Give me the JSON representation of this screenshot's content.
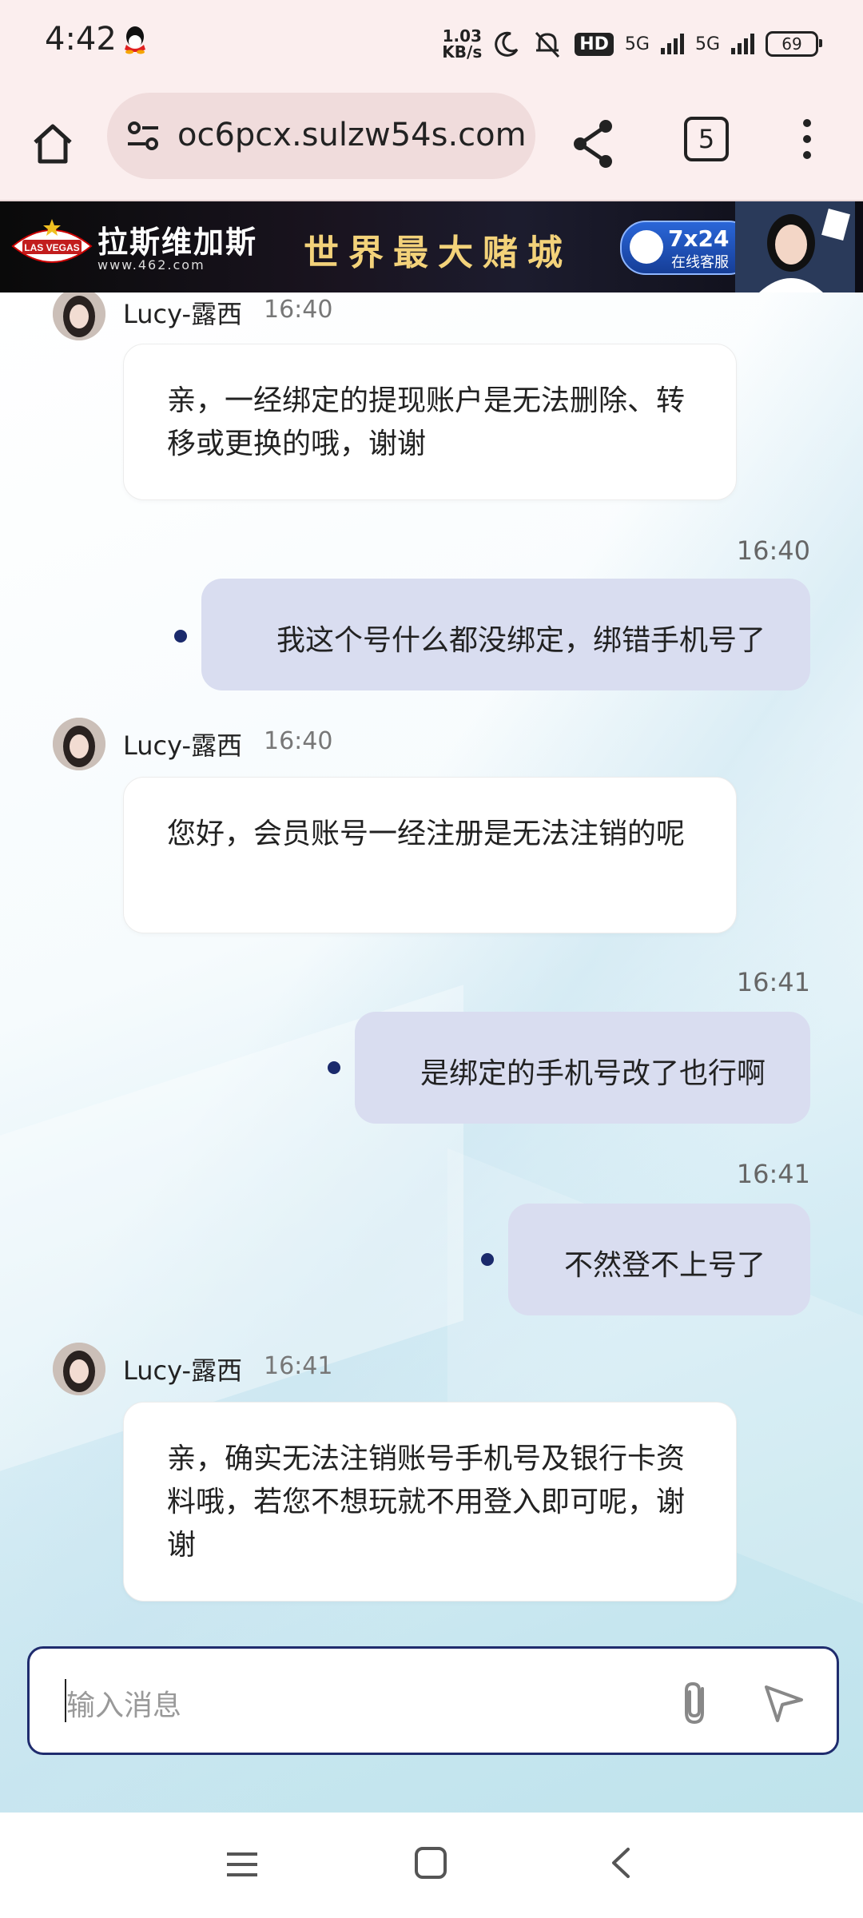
{
  "status_bar": {
    "time": "4:42",
    "net_speed": "1.03",
    "net_unit": "KB/s",
    "hd": "HD",
    "sim1": "5G",
    "sim2": "5G",
    "battery": "69"
  },
  "browser": {
    "url": "oc6pcx.sulzw54s.com",
    "tab_count": "5"
  },
  "banner": {
    "brand": "拉斯维加斯",
    "site": "www.462.com",
    "slogan": "世界最大赌城",
    "service_top": "7x24",
    "service_bottom": "在线客服",
    "logo_text": "LAS VEGAS"
  },
  "messages": [
    {
      "from": "agent",
      "name": "Lucy-露西",
      "time": "16:40",
      "text": "亲，一经绑定的提现账户是无法删除、转移或更换的哦，谢谢"
    },
    {
      "from": "user",
      "time": "16:40",
      "text": "我这个号什么都没绑定，绑错手机号了"
    },
    {
      "from": "agent",
      "name": "Lucy-露西",
      "time": "16:40",
      "text": "您好，会员账号一经注册是无法注销的呢"
    },
    {
      "from": "user",
      "time": "16:41",
      "text": "是绑定的手机号改了也行啊"
    },
    {
      "from": "user",
      "time": "16:41",
      "text": "不然登不上号了"
    },
    {
      "from": "agent",
      "name": "Lucy-露西",
      "time": "16:41",
      "text": "亲，确实无法注销账号手机号及银行卡资料哦，若您不想玩就不用登入即可呢，谢谢"
    }
  ],
  "composer": {
    "placeholder": "输入消息"
  },
  "colors": {
    "user_bubble": "#d9ddf0",
    "agent_bubble": "#ffffff",
    "dot": "#1a2a6c",
    "composer_border": "#1f2c6e"
  }
}
